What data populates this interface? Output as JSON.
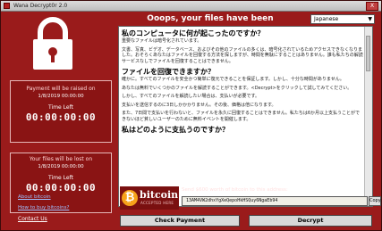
{
  "window": {
    "title": "Wana Decrypt0r 2.0",
    "close_label": "X"
  },
  "header": {
    "headline": "Ooops, your files have been encrypted!",
    "language": "Japanese"
  },
  "panel1": {
    "label": "Payment will be raised on",
    "date": "1/8/2019 00:00:00",
    "time_left_label": "Time Left",
    "countdown": "00:00:00:00"
  },
  "panel2": {
    "label": "Your files will be lost on",
    "date": "1/8/2019 00:00:00",
    "time_left_label": "Time Left",
    "countdown": "00:00:00:00"
  },
  "links": {
    "about_bitcoin": "About bitcoin",
    "how_to_buy": "How to buy bitcoins?",
    "contact": "Contact Us"
  },
  "content": {
    "h1": "私のコンピュータに何が起こったのですか？",
    "p1": "重要なファイルは暗号化されています。",
    "p2": "文書、写真、ビデオ、データベース、およびその他のファイルの多くは、暗号化されているためアクセスできなくなりました。おそらくあなたはファイルを回復する方法を探しますが、時間を無駄にすることはありません。誰も私たちの解読サービスなしでファイルを回復することはできません。",
    "h2": "ファイルを回復できますか？",
    "p3": "確かに。すべてのファイルを安全かつ簡単に復元できることを保証します。しかし、十分な時間がありません。",
    "p4": "あなたは無料でいくつかのファイルを解読することができます。<Decrypt>をクリックして試してみてください。",
    "p5": "しかし、すべてのファイルを解読したい場合は、支払いが必要です。",
    "p6": "支払いを送信するのに3日しかかかりません。その後、価格は倍になります。",
    "p7": "また、7日間で支払いを行わないと、ファイルを永久に回復することはできません。私たちは6か月以上支払うことができないほど貧しいユーザーのために無料イベントを開催します。",
    "h3": "私はどのように支払うのですか？"
  },
  "bitcoin": {
    "logo_word": "bitcoin",
    "logo_sub": "ACCEPTED HERE",
    "send_text": "Send $600 worth of bitcoin to this address:",
    "address": "13AM4VW2dhxYgXeQepoHkHSQuy6NgaEb94",
    "copy_label": "Copy"
  },
  "buttons": {
    "check_payment": "Check Payment",
    "decrypt": "Decrypt"
  },
  "colors": {
    "background": "#9a1b1b",
    "content": "#ffffff",
    "bitcoin_orange": "#f7a21a"
  },
  "icons": {
    "lock": "padlock-icon",
    "bitcoin": "bitcoin-icon"
  }
}
